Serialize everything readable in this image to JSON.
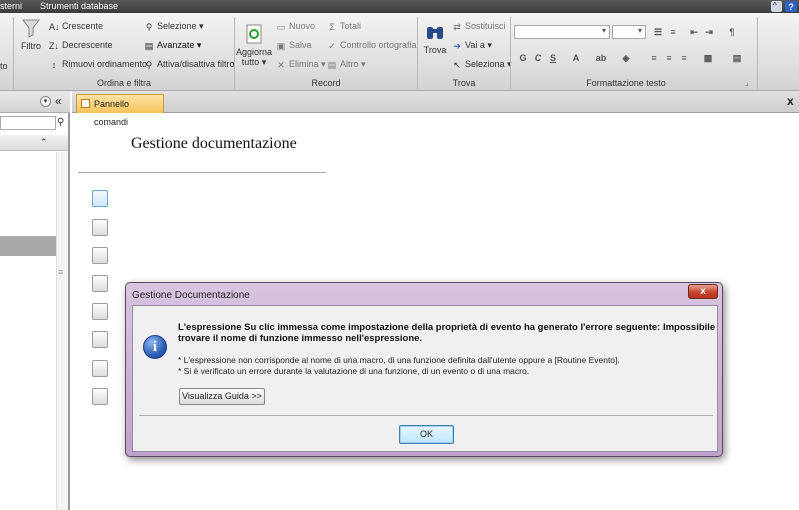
{
  "topbar": {
    "tab_external": "sterni",
    "tab_dbtools": "Strumenti database",
    "help_icon": "?"
  },
  "ribbon": {
    "filter_partial": "to",
    "filter": {
      "label": "Filtro"
    },
    "sort_filter": {
      "ascending": "Crescente",
      "descending": "Decrescente",
      "remove_sort": "Rimuovi ordinamento",
      "selection": "Selezione",
      "advanced": "Avanzate",
      "toggle_filter": "Attiva/disattiva filtro",
      "group_label": "Ordina e filtra"
    },
    "records": {
      "refresh_line1": "Aggiorna",
      "refresh_line2": "tutto",
      "new": "Nuovo",
      "save": "Salva",
      "delete": "Elimina",
      "totals": "Totali",
      "spelling": "Controllo ortografia",
      "more": "Altro",
      "group_label": "Record"
    },
    "find": {
      "find": "Trova",
      "replace": "Sostituisci",
      "goto": "Vai a",
      "select": "Seleziona",
      "group_label": "Trova"
    },
    "text_format": {
      "bold": "G",
      "italic": "C",
      "underline": "S",
      "group_label": "Formattazione testo"
    }
  },
  "nav_pane": {
    "collapse_icon": "«"
  },
  "document": {
    "tab_label": "Pannello comandi",
    "close": "x",
    "form_title": "Gestione documentazione",
    "button_count": 8
  },
  "dialog": {
    "title": "Gestione Documentazione",
    "close": "x",
    "message_main": "L'espressione Su clic immessa come impostazione della proprietà di evento ha generato l'errore seguente: Impossibile trovare il nome di funzione immesso nell'espressione.",
    "detail_1": "* L'espressione non corrisponde al nome di una macro, di una funzione definita dall'utente oppure a [Routine Evento].",
    "detail_2": "* Si è verificato un errore durante la valutazione di una funzione, di un evento o di una macro.",
    "help_button": "Visualizza Guida >>",
    "ok_button": "OK"
  },
  "colors": {
    "dialog_frame": "#bfa2cc",
    "tab_active": "#f7c45a",
    "info_icon": "#2d5eb8",
    "close_button": "#c2412a"
  }
}
